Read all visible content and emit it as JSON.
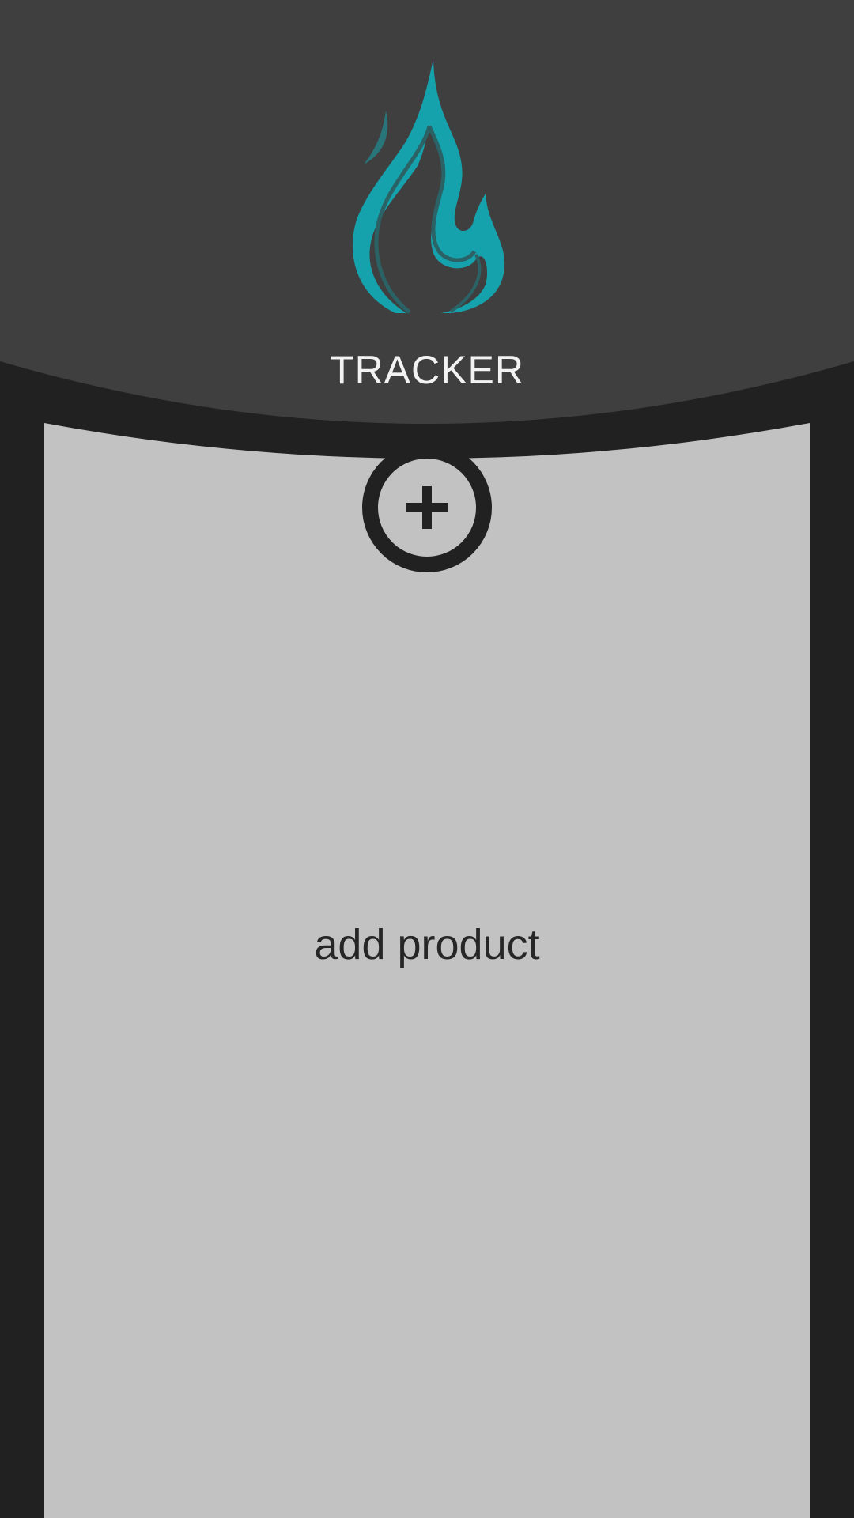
{
  "header": {
    "title": "TRACKER",
    "logo_icon": "flame-icon"
  },
  "main": {
    "add_button_icon": "plus-icon",
    "add_product_label": "add product"
  },
  "colors": {
    "background": "#212121",
    "header": "#3f3f3f",
    "panel": "#c2c2c2",
    "accent": "#15a2ac",
    "title_text": "#f2f2f2",
    "body_text": "#262626"
  }
}
